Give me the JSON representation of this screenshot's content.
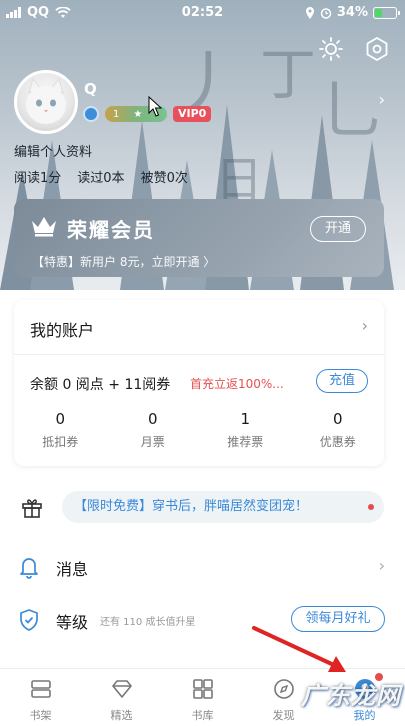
{
  "status_bar": {
    "carrier": "QQ",
    "time": "02:52",
    "battery": "34%",
    "battery_level": 0.34
  },
  "profile": {
    "username": "Q",
    "level_badge": "1",
    "vip_badge": "VIP0",
    "edit_label": "编辑个人资料",
    "stats": [
      {
        "label": "阅读1分"
      },
      {
        "label": "读过0本"
      },
      {
        "label": "被赞0次"
      }
    ]
  },
  "member": {
    "title": "荣耀会员",
    "promo": "【特惠】新用户 8元，立即开通 〉",
    "open_label": "开通"
  },
  "account": {
    "title": "我的账户",
    "balance": "余额  0 阅点 + 11阅券",
    "recharge_tip": "首充立返100%...",
    "recharge_label": "充值",
    "items": [
      {
        "value": "0",
        "label": "抵扣券"
      },
      {
        "value": "0",
        "label": "月票"
      },
      {
        "value": "1",
        "label": "推荐票"
      },
      {
        "value": "0",
        "label": "优惠券"
      }
    ]
  },
  "gift_banner": {
    "tag": "【限时免费】",
    "text": "穿书后，胖喵居然变团宠！"
  },
  "rows": {
    "messages": {
      "label": "消息"
    },
    "level": {
      "label": "等级",
      "hint": "还有 110 成长值升星",
      "action": "领每月好礼"
    }
  },
  "nav": [
    {
      "label": "书架",
      "icon": "bookshelf-icon"
    },
    {
      "label": "精选",
      "icon": "diamond-icon"
    },
    {
      "label": "书库",
      "icon": "grid-icon"
    },
    {
      "label": "发现",
      "icon": "compass-icon"
    },
    {
      "label": "我的",
      "icon": "profile-icon"
    }
  ],
  "watermark": "广东龙网",
  "colors": {
    "accent": "#3b89d8",
    "alert": "#e74c4c",
    "vip": "#e8505b"
  }
}
